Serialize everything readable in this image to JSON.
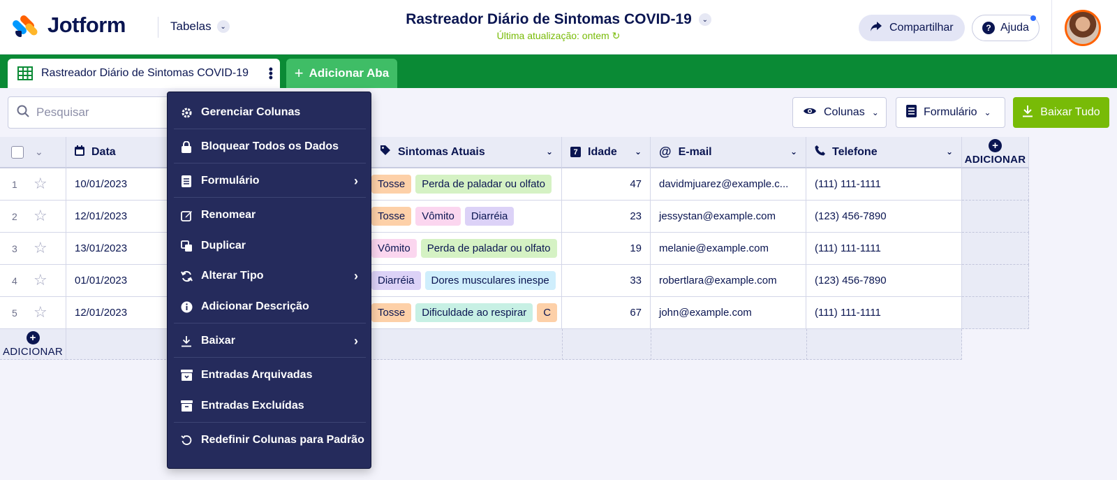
{
  "brand": {
    "name": "Jotform"
  },
  "header": {
    "tables_label": "Tabelas",
    "title": "Rastreador Diário de Sintomas COVID-19",
    "last_update": "Última atualização: ontem",
    "share_label": "Compartilhar",
    "help_label": "Ajuda"
  },
  "tabs": {
    "active_label": "Rastreador Diário de Sintomas COVID-19",
    "add_label": "Adicionar Aba"
  },
  "toolbar": {
    "search_placeholder": "Pesquisar",
    "columns_label": "Colunas",
    "form_label": "Formulário",
    "download_label": "Baixar Tudo"
  },
  "table": {
    "columns": {
      "date": "Data",
      "symptoms": "Sintomas Atuais",
      "age": "Idade",
      "email": "E-mail",
      "phone": "Telefone"
    },
    "add_column_label": "ADICIONAR",
    "add_row_label": "ADICIONAR",
    "rows": [
      {
        "num": "1",
        "date": "10/01/2023",
        "symptoms": [
          "Tosse",
          "Perda de paladar ou olfato"
        ],
        "age": "47",
        "email": "davidmjuarez@example.c...",
        "phone": "(111) 111-1111"
      },
      {
        "num": "2",
        "date": "12/01/2023",
        "symptoms": [
          "Tosse",
          "Vômito",
          "Diarréia"
        ],
        "age": "23",
        "email": "jessystan@example.com",
        "phone": "(123) 456-7890"
      },
      {
        "num": "3",
        "date": "13/01/2023",
        "symptoms": [
          "Vômito",
          "Perda de paladar ou olfato"
        ],
        "age": "19",
        "email": "melanie@example.com",
        "phone": "(111) 111-1111"
      },
      {
        "num": "4",
        "date": "01/01/2023",
        "symptoms": [
          "Diarréia",
          "Dores musculares inespe"
        ],
        "age": "33",
        "email": "robertlara@example.com",
        "phone": "(123) 456-7890"
      },
      {
        "num": "5",
        "date": "12/01/2023",
        "symptoms": [
          "Tosse",
          "Dificuldade ao respirar",
          "C"
        ],
        "age": "67",
        "email": "john@example.com",
        "phone": "(111) 111-1111"
      }
    ],
    "tag_colors": {
      "Tosse": "#fdd0a8",
      "Perda de paladar ou olfato": "#d5f2c4",
      "Vômito": "#fbd6ef",
      "Diarréia": "#dcd2f7",
      "Dores musculares inespe": "#cfeefc",
      "Dificuldade ao respirar": "#c7f0e4",
      "C": "#fdd0a8"
    }
  },
  "menu": {
    "items": [
      {
        "label": "Gerenciar Colunas",
        "icon": "gear-icon",
        "submenu": false
      },
      {
        "label": "Bloquear Todos os Dados",
        "icon": "lock-icon",
        "submenu": false
      },
      {
        "label": "Formulário",
        "icon": "form-icon",
        "submenu": true
      },
      {
        "label": "Renomear",
        "icon": "edit-icon",
        "submenu": false
      },
      {
        "label": "Duplicar",
        "icon": "duplicate-icon",
        "submenu": false
      },
      {
        "label": "Alterar Tipo",
        "icon": "refresh-icon",
        "submenu": true
      },
      {
        "label": "Adicionar Descrição",
        "icon": "info-icon",
        "submenu": false
      },
      {
        "label": "Baixar",
        "icon": "download-icon",
        "submenu": true
      },
      {
        "label": "Entradas Arquivadas",
        "icon": "archive-icon",
        "submenu": false
      },
      {
        "label": "Entradas Excluídas",
        "icon": "trash-box-icon",
        "submenu": false
      },
      {
        "label": "Redefinir Colunas para Padrão",
        "icon": "reset-icon",
        "submenu": false
      }
    ]
  },
  "colors": {
    "brand_navy": "#0a1551",
    "tab_bar_green": "#0a8a35",
    "download_green": "#78bb07",
    "menu_bg": "#252b5c",
    "avatar_ring": "#ff6100"
  }
}
